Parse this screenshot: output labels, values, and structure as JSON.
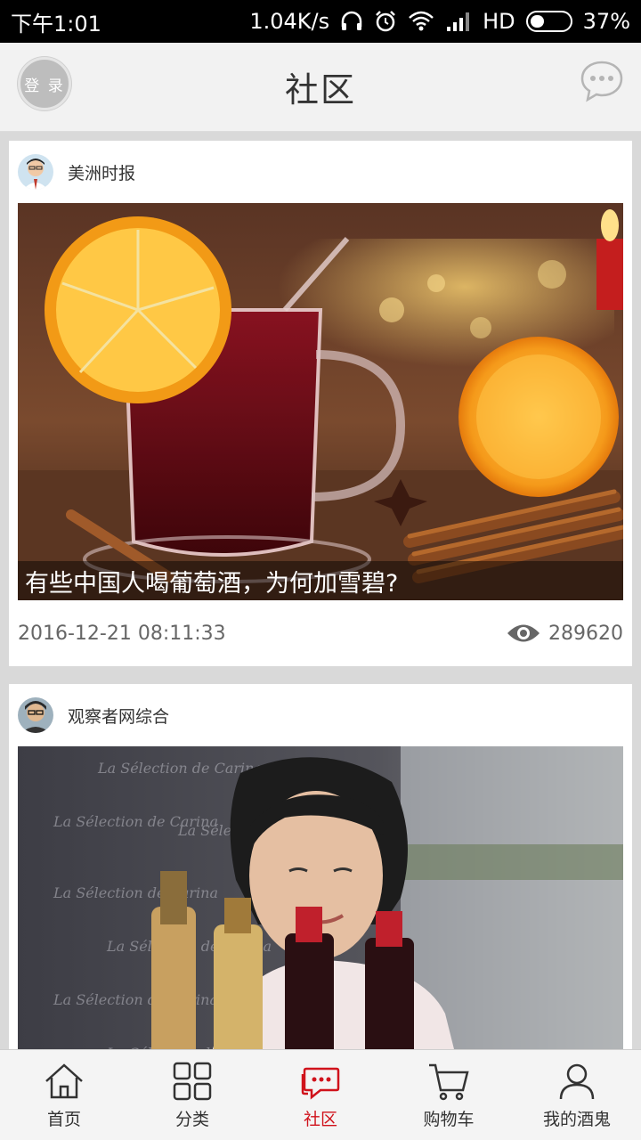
{
  "status_bar": {
    "time": "下午1:01",
    "network_speed": "1.04K/s",
    "network_type": "HD",
    "battery": "37%",
    "battery_level": 0.37
  },
  "header": {
    "login_label": "登 录",
    "title": "社区"
  },
  "feed": {
    "items": [
      {
        "source": "美洲时报",
        "caption": "有些中国人喝葡萄酒，为何加雪碧?",
        "datetime": "2016-12-21 08:11:33",
        "views": "289620"
      },
      {
        "source": "观察者网综合",
        "caption": "",
        "datetime": "",
        "views": ""
      }
    ]
  },
  "tabs": [
    {
      "label": "首页",
      "icon": "home-icon"
    },
    {
      "label": "分类",
      "icon": "grid-icon"
    },
    {
      "label": "社区",
      "icon": "chat-icon",
      "active": true
    },
    {
      "label": "购物车",
      "icon": "cart-icon"
    },
    {
      "label": "我的酒鬼",
      "icon": "user-icon"
    }
  ],
  "colors": {
    "accent": "#d0121b",
    "header_bg": "#f2f2f2",
    "tabbar_bg": "#f4f4f4"
  }
}
